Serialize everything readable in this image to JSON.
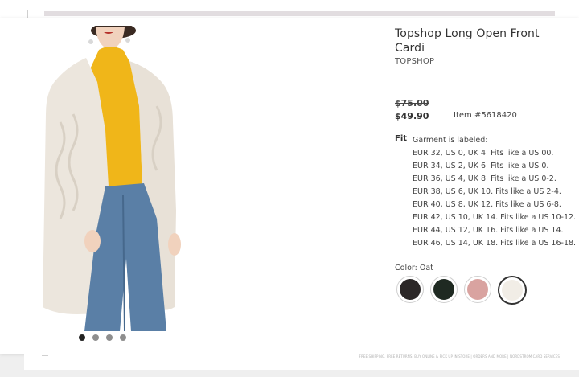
{
  "product": {
    "title": "Topshop Long Open Front Cardi",
    "brand": "TOPSHOP",
    "original_price": "$75.00",
    "sale_price": "$49.90",
    "item_number": "Item #5618420"
  },
  "fit": {
    "label": "Fit",
    "intro": "Garment is labeled:",
    "sizes": [
      "EUR 32, US 0, UK 4. Fits like a US 00.",
      "EUR 34, US 2, UK 6. Fits like a US 0.",
      "EUR 36, US 4, UK 8. Fits like a US 0-2.",
      "EUR 38, US 6, UK 10. Fits like a US 2-4.",
      "EUR 40, US 8, UK 12. Fits like a US 6-8.",
      "EUR 42, US 10, UK 14. Fits like a US 10-12.",
      "EUR 44, US 12, UK 16. Fits like a US 14.",
      "EUR 46, US 14, UK 18. Fits like a US 16-18."
    ]
  },
  "color": {
    "label": "Color: Oat",
    "swatches": [
      {
        "name": "Black",
        "hex": "#2b2727",
        "selected": false
      },
      {
        "name": "Dark Green",
        "hex": "#1f2a22",
        "selected": false
      },
      {
        "name": "Pink",
        "hex": "#d9a3a0",
        "selected": false
      },
      {
        "name": "Oat",
        "hex": "#f1ede6",
        "selected": true
      }
    ]
  },
  "gallery": {
    "dot_count": 4,
    "active_dot": 0
  },
  "footer": {
    "text": "FREE SHIPPING. FREE RETURNS. BUY ONLINE & PICK UP IN STORE | ORDERS AND MORE | NORDSTROM CARD SERVICES"
  },
  "colors": {
    "cardigan": "#ece6dd",
    "top": "#f0b619",
    "jeans": "#5a7fa6",
    "skin": "#f1d2bd",
    "hair": "#3a2a22"
  }
}
